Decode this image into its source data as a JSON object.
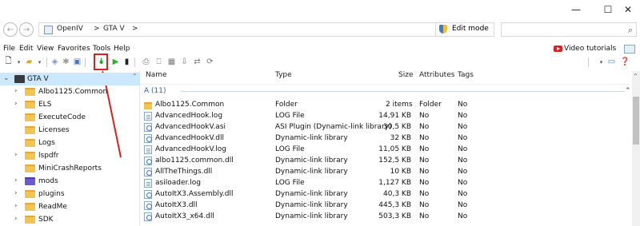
{
  "window": {
    "minimize": "—",
    "maximize": "☐",
    "close": "✕"
  },
  "address": {
    "back_icon": "back-arrow-icon",
    "forward_icon": "forward-arrow-icon",
    "breadcrumb": [
      "OpenIV",
      ">",
      "GTA V",
      ">"
    ],
    "edit_mode": "Edit mode",
    "search_placeholder": ""
  },
  "menu": {
    "items": [
      "File",
      "Edit",
      "View",
      "Favorites",
      "Tools",
      "Help"
    ],
    "video_tutorials": "Video tutorials"
  },
  "tree": {
    "root": "GTA V",
    "items": [
      {
        "label": "Albo1125.Common",
        "expandable": true
      },
      {
        "label": "ELS",
        "expandable": true
      },
      {
        "label": "ExecuteCode",
        "expandable": false
      },
      {
        "label": "Licenses",
        "expandable": false
      },
      {
        "label": "Logs",
        "expandable": false
      },
      {
        "label": "lspdfr",
        "expandable": true
      },
      {
        "label": "MiniCrashReports",
        "expandable": false
      },
      {
        "label": "mods",
        "expandable": true
      },
      {
        "label": "plugins",
        "expandable": true
      },
      {
        "label": "ReadMe",
        "expandable": true
      },
      {
        "label": "SDK",
        "expandable": true
      }
    ]
  },
  "list": {
    "columns": {
      "name": "Name",
      "type": "Type",
      "size": "Size",
      "attributes": "Attributes",
      "tags": "Tags"
    },
    "group": "A (11)",
    "rows": [
      {
        "icon": "folder",
        "name": "Albo1125.Common",
        "type": "Folder",
        "size": "2 items",
        "attributes": "Folder",
        "tags": "No"
      },
      {
        "icon": "log",
        "name": "AdvancedHook.log",
        "type": "LOG File",
        "size": "14,91 KB",
        "attributes": "No",
        "tags": "No"
      },
      {
        "icon": "dll",
        "name": "AdvancedHookV.asi",
        "type": "ASI Plugin (Dynamic-link library)",
        "size": "30,5 KB",
        "attributes": "No",
        "tags": "No"
      },
      {
        "icon": "dll",
        "name": "AdvancedHookV.dll",
        "type": "Dynamic-link library",
        "size": "32 KB",
        "attributes": "No",
        "tags": "No"
      },
      {
        "icon": "log",
        "name": "AdvancedHookV.log",
        "type": "LOG File",
        "size": "11,05 KB",
        "attributes": "No",
        "tags": "No"
      },
      {
        "icon": "dll",
        "name": "albo1125.common.dll",
        "type": "Dynamic-link library",
        "size": "152,5 KB",
        "attributes": "No",
        "tags": "No"
      },
      {
        "icon": "dll",
        "name": "AllTheThings.dll",
        "type": "Dynamic-link library",
        "size": "10 KB",
        "attributes": "No",
        "tags": "No"
      },
      {
        "icon": "log",
        "name": "asiloader.log",
        "type": "LOG File",
        "size": "1,127 KB",
        "attributes": "No",
        "tags": "No"
      },
      {
        "icon": "dll",
        "name": "AutoItX3.Assembly.dll",
        "type": "Dynamic-link library",
        "size": "40,3 KB",
        "attributes": "No",
        "tags": "No"
      },
      {
        "icon": "dll",
        "name": "AutoItX3.dll",
        "type": "Dynamic-link library",
        "size": "445,3 KB",
        "attributes": "No",
        "tags": "No"
      },
      {
        "icon": "dll",
        "name": "AutoItX3_x64.dll",
        "type": "Dynamic-link library",
        "size": "503,3 KB",
        "attributes": "No",
        "tags": "No"
      }
    ]
  },
  "colors": {
    "selection": "#cce8ff",
    "group_blue": "#1e63b6",
    "highlight_red": "#e01e1e",
    "folder_yellow": "#f3c44f"
  }
}
